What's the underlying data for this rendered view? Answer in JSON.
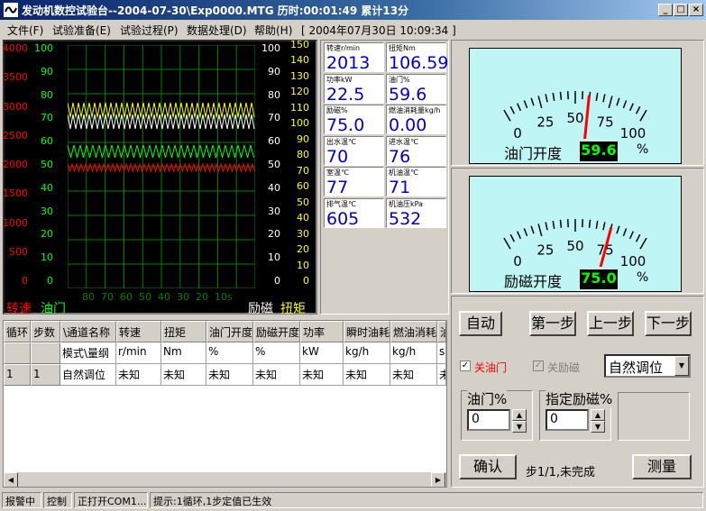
{
  "window": {
    "title": "发动机数控试验台--2004-07-30\\Exp0000.MTG  历时:00:01:49  累计13分",
    "min_label": "_",
    "max_label": "□",
    "close_label": "×"
  },
  "menu": {
    "file": "文件(F)",
    "prep": "试验准备(E)",
    "process": "试验过程(P)",
    "data": "数据处理(D)",
    "help": "帮助(H)",
    "datetime": "[ 2004年07月30日 10:09:34 ]"
  },
  "graph": {
    "left_axis_speed": [
      "4000",
      "3500",
      "3000",
      "2500",
      "2000",
      "1500",
      "1000",
      "500",
      "0"
    ],
    "left_axis_throttle": [
      "100",
      "90",
      "80",
      "70",
      "60",
      "50",
      "40",
      "30",
      "20",
      "10",
      "0"
    ],
    "right_axis_excite": [
      "100",
      "90",
      "80",
      "70",
      "60",
      "50",
      "40",
      "30",
      "20",
      "10",
      "0"
    ],
    "right_axis_torque": [
      "150",
      "140",
      "130",
      "120",
      "110",
      "100",
      "90",
      "80",
      "70",
      "60",
      "50",
      "40",
      "30",
      "20",
      "10",
      "0"
    ],
    "x_ticks": [
      "80",
      "70",
      "60",
      "50",
      "40",
      "30",
      "20",
      "10s"
    ],
    "label_speed": "转速",
    "label_throttle": "油门",
    "label_excite": "励磁",
    "label_torque": "扭矩",
    "colors": {
      "speed": "#ff0000",
      "throttle": "#00ff00",
      "excite": "#ffffff",
      "torque": "#ffff00",
      "grid": "#008000"
    }
  },
  "readouts": [
    {
      "label": "转速r/min",
      "value": "2013"
    },
    {
      "label": "扭矩Nm",
      "value": "106.59"
    },
    {
      "label": "功率kW",
      "value": "22.5"
    },
    {
      "label": "油门%",
      "value": "59.6"
    },
    {
      "label": "励磁%",
      "value": "75.0"
    },
    {
      "label": "燃油消耗量kg/h",
      "value": "0.00"
    },
    {
      "label": "出水温℃",
      "value": "70"
    },
    {
      "label": "进水温℃",
      "value": "76"
    },
    {
      "label": "室温℃",
      "value": "77"
    },
    {
      "label": "机油温℃",
      "value": "71"
    },
    {
      "label": "排气温℃",
      "value": "605"
    },
    {
      "label": "机油压kPa",
      "value": "532"
    }
  ],
  "gauges": [
    {
      "title": "油门开度",
      "value": "59.6",
      "unit": "%",
      "level": 59.6,
      "ticks": [
        "0",
        "25",
        "50",
        "75",
        "100"
      ]
    },
    {
      "title": "励磁开度",
      "value": "75.0",
      "unit": "%",
      "level": 75.0,
      "ticks": [
        "0",
        "25",
        "50",
        "75",
        "100"
      ]
    }
  ],
  "table": {
    "headers": [
      "循环",
      "步数",
      "\\通道名称",
      "转速",
      "扭矩",
      "油门开度",
      "励磁开度",
      "功率",
      "瞬时油耗",
      "燃油消耗",
      "油"
    ],
    "rows": [
      [
        "",
        "",
        "模式\\量纲",
        "r/min",
        "Nm",
        "%",
        "%",
        "kW",
        "kg/h",
        "kg/h",
        "s"
      ],
      [
        "1",
        "1",
        "自然调位",
        "未知",
        "未知",
        "未知",
        "未知",
        "未知",
        "未知",
        "未知",
        "未"
      ]
    ]
  },
  "controls": {
    "auto": "自动",
    "step1": "第一步",
    "prev": "上一步",
    "next": "下一步",
    "close_throttle": "关油门",
    "close_excite": "关励磁",
    "mode": "自然调位",
    "throttle_label": "油门%",
    "throttle_value": "0",
    "excite_label": "指定励磁%",
    "excite_value": "0",
    "confirm": "确认",
    "step_status": "步1/1,未完成",
    "measure": "测量"
  },
  "status": {
    "alarm": "报警中",
    "control": "控制",
    "com": "正打开COM1...",
    "hint": "提示:1循环,1步定值已生效"
  }
}
